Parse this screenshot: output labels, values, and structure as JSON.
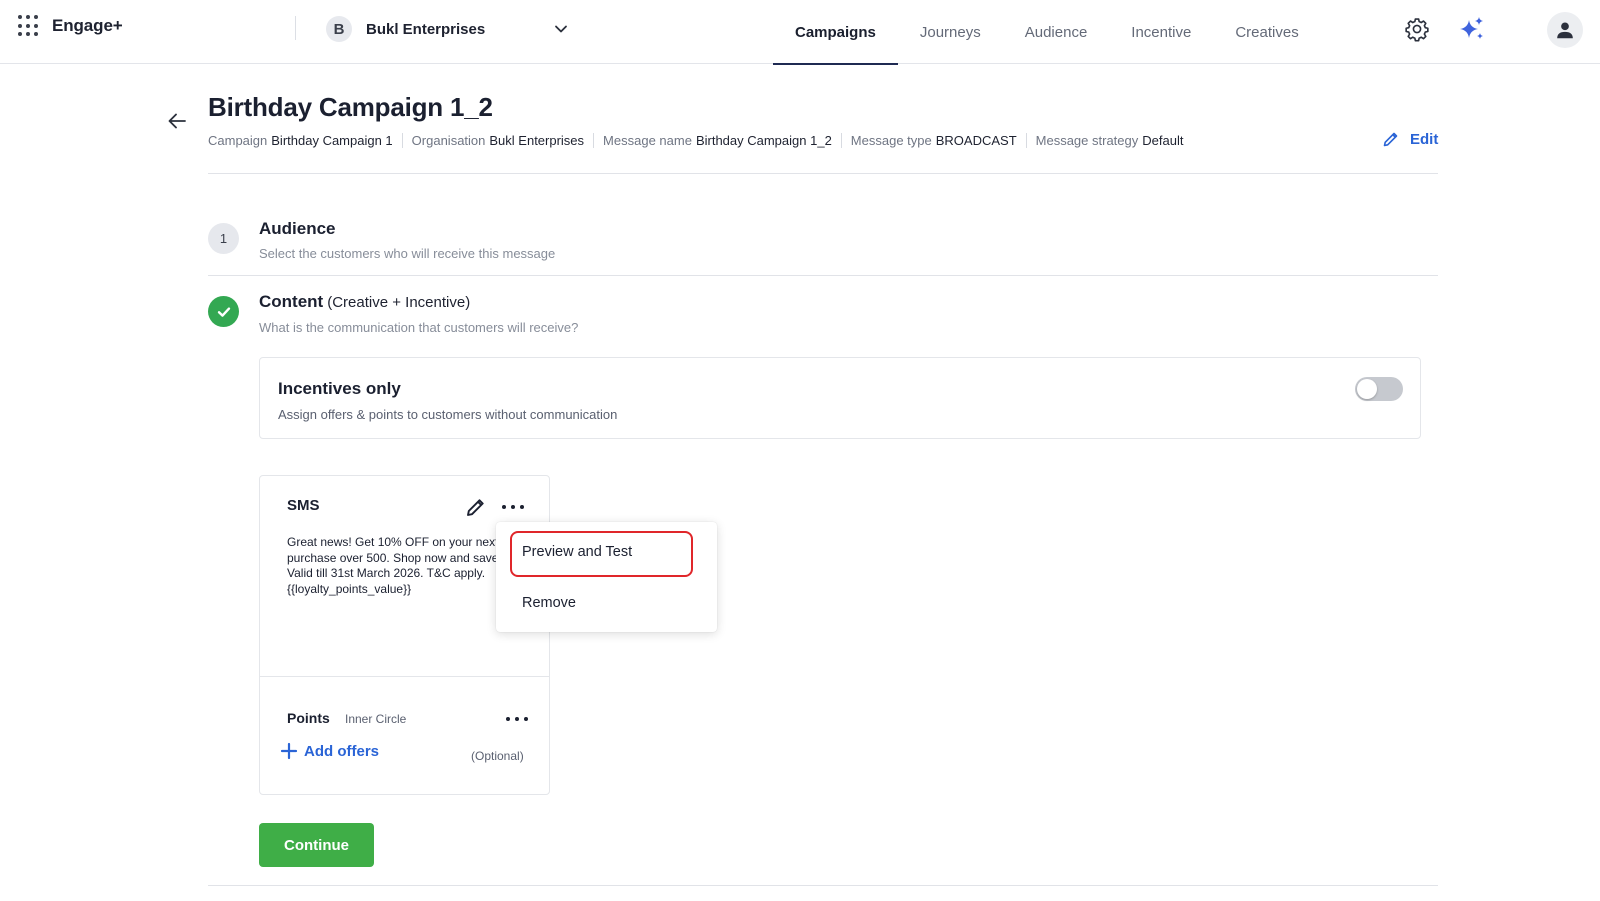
{
  "app": {
    "brand": "Engage+"
  },
  "org_switcher": {
    "avatar_letter": "B",
    "name": "Bukl Enterprises"
  },
  "nav": {
    "tabs": [
      {
        "label": "Campaigns",
        "active": true
      },
      {
        "label": "Journeys",
        "active": false
      },
      {
        "label": "Audience",
        "active": false
      },
      {
        "label": "Incentive",
        "active": false
      },
      {
        "label": "Creatives",
        "active": false
      }
    ]
  },
  "header": {
    "title": "Birthday Campaign 1_2",
    "meta": [
      {
        "label": "Campaign",
        "value": "Birthday Campaign 1"
      },
      {
        "label": "Organisation",
        "value": "Bukl Enterprises"
      },
      {
        "label": "Message name",
        "value": "Birthday Campaign 1_2"
      },
      {
        "label": "Message type",
        "value": "BROADCAST"
      },
      {
        "label": "Message strategy",
        "value": "Default"
      }
    ],
    "edit_label": "Edit"
  },
  "steps": {
    "audience": {
      "number": "1",
      "title": "Audience",
      "subtitle": "Select the customers who will receive this message"
    },
    "content": {
      "title": "Content",
      "title_suffix": "(Creative + Incentive)",
      "subtitle": "What is the communication that customers will receive?",
      "status": "complete"
    }
  },
  "incentives_only": {
    "title": "Incentives only",
    "subtitle": "Assign offers & points to customers without communication",
    "enabled": false
  },
  "sms_card": {
    "title": "SMS",
    "body": "Great news! Get 10% OFF on your next\npurchase over 500. Shop now and save!\nValid till 31st March 2026. T&C apply.\n{{loyalty_points_value}}",
    "points_label": "Points",
    "points_program": "Inner Circle",
    "add_offers_label": "Add offers",
    "optional_label": "(Optional)"
  },
  "context_menu": {
    "items": [
      "Preview and Test",
      "Remove"
    ],
    "highlighted_item": "Preview and Test"
  },
  "buttons": {
    "continue": "Continue"
  },
  "colors": {
    "accent_blue": "#2a64d6",
    "success_green": "#33a852",
    "continue_green": "#3fae47",
    "highlight_red": "#e0262a",
    "nav_active_underline": "#1f2a52"
  },
  "icons": [
    "apps-grid-icon",
    "chevron-down-icon",
    "settings-icon",
    "sparkle-icon",
    "user-profile-icon",
    "back-arrow-icon",
    "pencil-icon",
    "check-icon",
    "more-horizontal-icon",
    "plus-icon"
  ]
}
